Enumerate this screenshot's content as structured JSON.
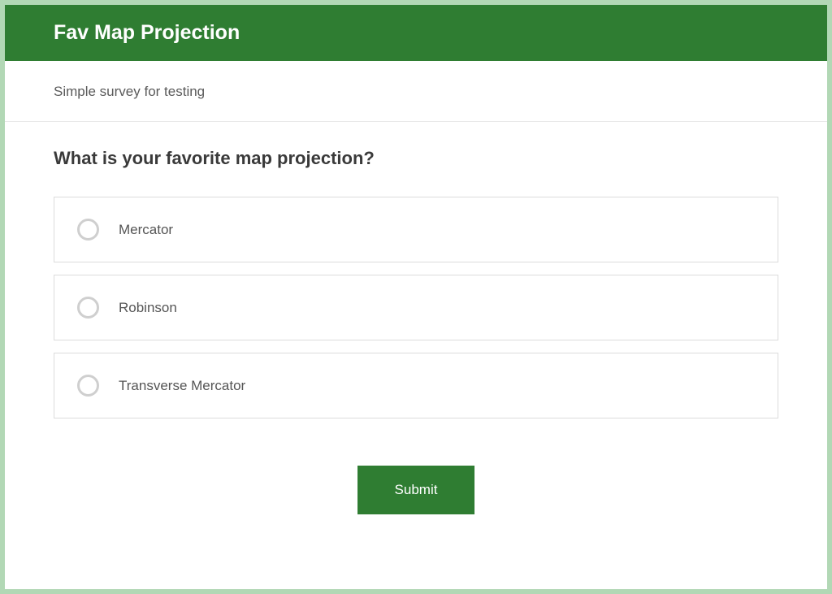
{
  "header": {
    "title": "Fav Map Projection"
  },
  "description": "Simple survey for testing",
  "question": {
    "text": "What is your favorite map projection?",
    "options": [
      {
        "label": "Mercator"
      },
      {
        "label": "Robinson"
      },
      {
        "label": "Transverse Mercator"
      }
    ]
  },
  "actions": {
    "submit_label": "Submit"
  },
  "colors": {
    "accent": "#2f7d32",
    "background": "#b2d8b5"
  }
}
